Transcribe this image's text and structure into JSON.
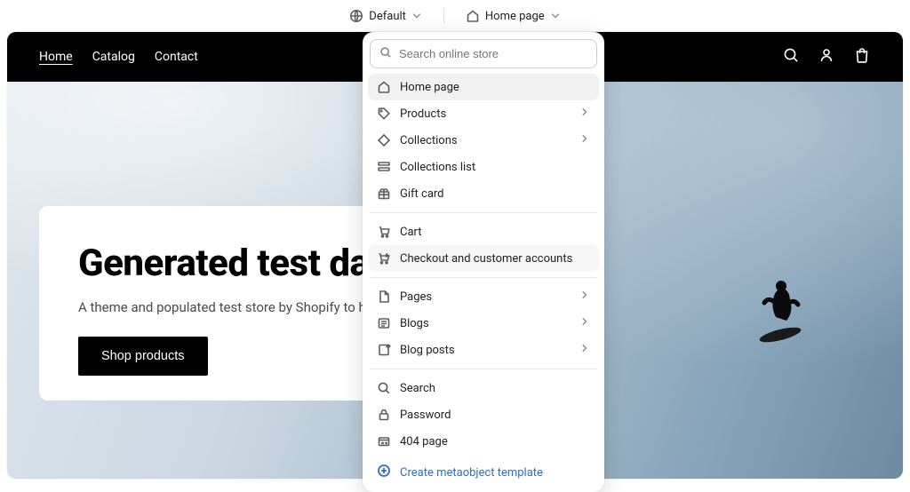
{
  "topbar": {
    "theme_label": "Default",
    "template_label": "Home page"
  },
  "store": {
    "nav": {
      "home": "Home",
      "catalog": "Catalog",
      "contact": "Contact"
    },
    "hero": {
      "heading": "Generated test data",
      "subtext": "A theme and populated test store by Shopify to help yo",
      "cta": "Shop products"
    }
  },
  "dropdown": {
    "search_placeholder": "Search online store",
    "groups": [
      [
        {
          "icon": "home",
          "label": "Home page",
          "selected": true
        },
        {
          "icon": "tag",
          "label": "Products",
          "has_children": true
        },
        {
          "icon": "diamond",
          "label": "Collections",
          "has_children": true
        },
        {
          "icon": "collections-list",
          "label": "Collections list"
        },
        {
          "icon": "gift",
          "label": "Gift card"
        }
      ],
      [
        {
          "icon": "cart",
          "label": "Cart"
        },
        {
          "icon": "checkout",
          "label": "Checkout and customer accounts",
          "hovered": true
        }
      ],
      [
        {
          "icon": "page",
          "label": "Pages",
          "has_children": true
        },
        {
          "icon": "blog",
          "label": "Blogs",
          "has_children": true
        },
        {
          "icon": "post",
          "label": "Blog posts",
          "has_children": true
        }
      ],
      [
        {
          "icon": "search",
          "label": "Search"
        },
        {
          "icon": "lock",
          "label": "Password"
        },
        {
          "icon": "404",
          "label": "404 page"
        }
      ]
    ],
    "create_label": "Create metaobject template"
  }
}
